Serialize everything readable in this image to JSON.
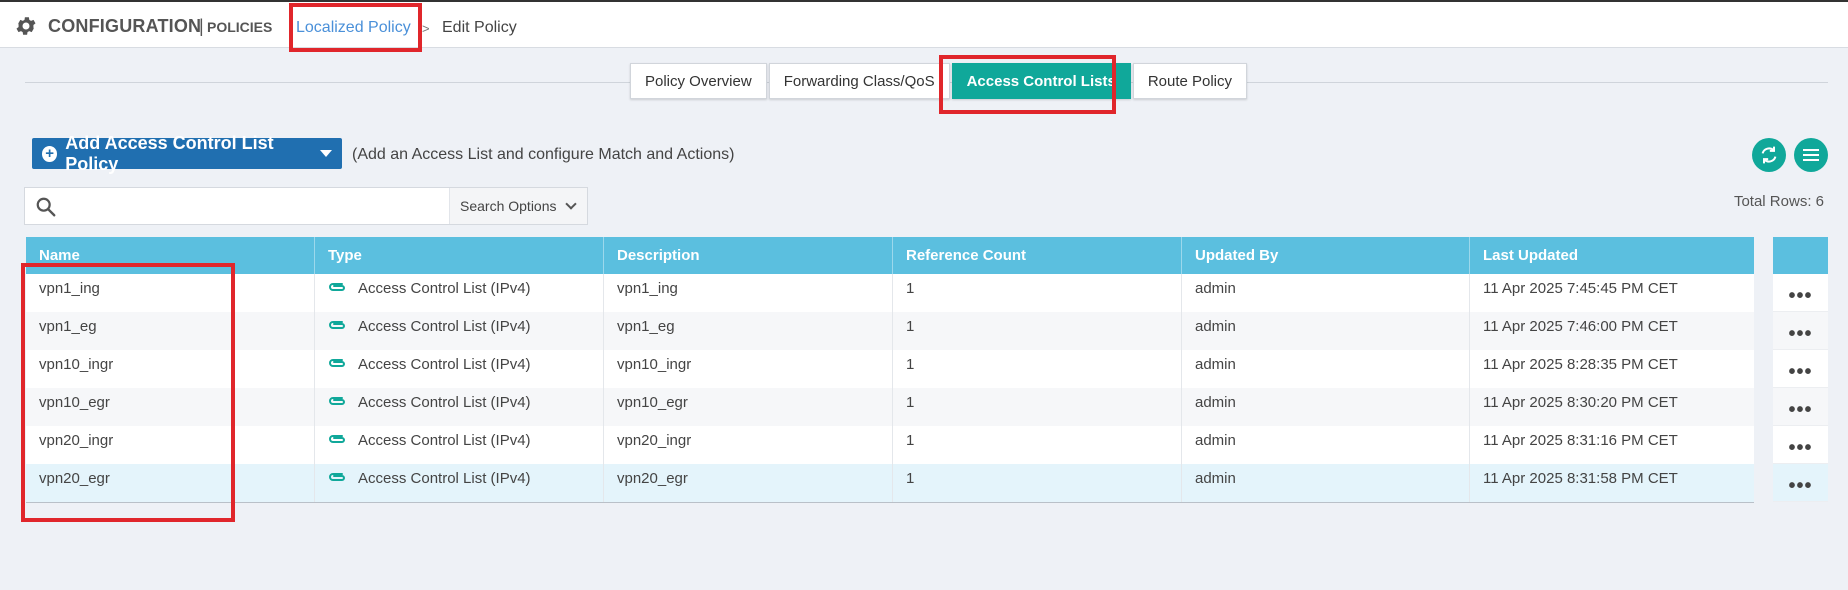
{
  "header": {
    "title": "CONFIGURATION",
    "separator": "|",
    "subtitle": "POLICIES",
    "breadcrumb_link": "Localized Policy",
    "breadcrumb_arrow": ">",
    "breadcrumb_current": "Edit Policy",
    "icon": "gear-icon"
  },
  "tabs": [
    {
      "label": "Policy Overview",
      "active": false
    },
    {
      "label": "Forwarding Class/QoS",
      "active": false
    },
    {
      "label": "Access Control Lists",
      "active": true
    },
    {
      "label": "Route Policy",
      "active": false
    }
  ],
  "toolbar": {
    "add_label": "Add Access Control List Policy",
    "add_hint": "(Add an Access List and configure Match and Actions)",
    "refresh_icon": "refresh-icon",
    "menu_icon": "menu-icon"
  },
  "search": {
    "value": "",
    "placeholder": "",
    "options_label": "Search Options"
  },
  "total_rows": "Total Rows: 6",
  "table": {
    "columns": [
      "Name",
      "Type",
      "Description",
      "Reference Count",
      "Updated By",
      "Last Updated"
    ],
    "rows": [
      {
        "name": "vpn1_ing",
        "type": "Access Control List (IPv4)",
        "description": "vpn1_ing",
        "reference_count": "1",
        "updated_by": "admin",
        "last_updated": "11 Apr 2025 7:45:45 PM CET"
      },
      {
        "name": "vpn1_eg",
        "type": "Access Control List (IPv4)",
        "description": "vpn1_eg",
        "reference_count": "1",
        "updated_by": "admin",
        "last_updated": "11 Apr 2025 7:46:00 PM CET"
      },
      {
        "name": "vpn10_ingr",
        "type": "Access Control List (IPv4)",
        "description": "vpn10_ingr",
        "reference_count": "1",
        "updated_by": "admin",
        "last_updated": "11 Apr 2025 8:28:35 PM CET"
      },
      {
        "name": "vpn10_egr",
        "type": "Access Control List (IPv4)",
        "description": "vpn10_egr",
        "reference_count": "1",
        "updated_by": "admin",
        "last_updated": "11 Apr 2025 8:30:20 PM CET"
      },
      {
        "name": "vpn20_ingr",
        "type": "Access Control List (IPv4)",
        "description": "vpn20_ingr",
        "reference_count": "1",
        "updated_by": "admin",
        "last_updated": "11 Apr 2025 8:31:16 PM CET"
      },
      {
        "name": "vpn20_egr",
        "type": "Access Control List (IPv4)",
        "description": "vpn20_egr",
        "reference_count": "1",
        "updated_by": "admin",
        "last_updated": "11 Apr 2025 8:31:58 PM CET"
      }
    ],
    "row_action_label": "•••"
  },
  "colors": {
    "accent": "#10a89a",
    "header_blue": "#5bbfdf",
    "button_blue": "#206fb0",
    "highlight_red": "#e0262b",
    "link": "#4a90d9"
  }
}
